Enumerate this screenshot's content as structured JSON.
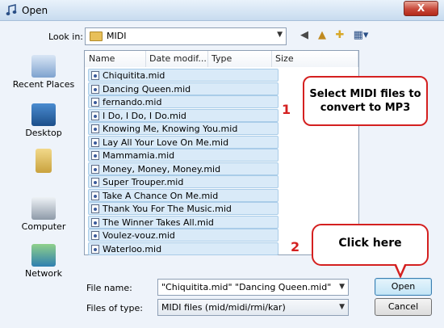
{
  "window": {
    "title": "Open",
    "close_label": "X"
  },
  "toolbar": {
    "lookin_label": "Look in:",
    "lookin_value": "MIDI",
    "icons": [
      "back-icon",
      "up-folder-icon",
      "new-folder-icon",
      "views-menu-icon"
    ]
  },
  "places": [
    {
      "label": "Recent Places",
      "icon": "recent-places-icon"
    },
    {
      "label": "Desktop",
      "icon": "desktop-icon"
    },
    {
      "label": "",
      "icon": "user-folder-icon"
    },
    {
      "label": "Computer",
      "icon": "computer-icon"
    },
    {
      "label": "Network",
      "icon": "network-icon"
    }
  ],
  "columns": [
    "Name",
    "Date modif...",
    "Type",
    "Size"
  ],
  "files": [
    "Chiquitita.mid",
    "Dancing Queen.mid",
    "fernando.mid",
    "I Do, I Do, I Do.mid",
    "Knowing Me, Knowing You.mid",
    "Lay All Your Love On Me.mid",
    "Mammamia.mid",
    "Money, Money, Money.mid",
    "Super Trouper.mid",
    "Take A Chance On Me.mid",
    "Thank You For The Music.mid",
    "The Winner Takes All.mid",
    "Voulez-vouz.mid",
    "Waterloo.mid"
  ],
  "callouts": {
    "step1_number": "1",
    "step1_text": "Select MIDI files to convert to MP3",
    "step2_number": "2",
    "step2_text": "Click here"
  },
  "form": {
    "filename_label": "File name:",
    "filename_value": "\"Chiquitita.mid\" \"Dancing Queen.mid\" \"fernand",
    "filetype_label": "Files of type:",
    "filetype_value": "MIDI files (mid/midi/rmi/kar)"
  },
  "buttons": {
    "open": "Open",
    "cancel": "Cancel"
  },
  "colors": {
    "accent_red": "#d42020",
    "selection": "#d9eaf8"
  }
}
